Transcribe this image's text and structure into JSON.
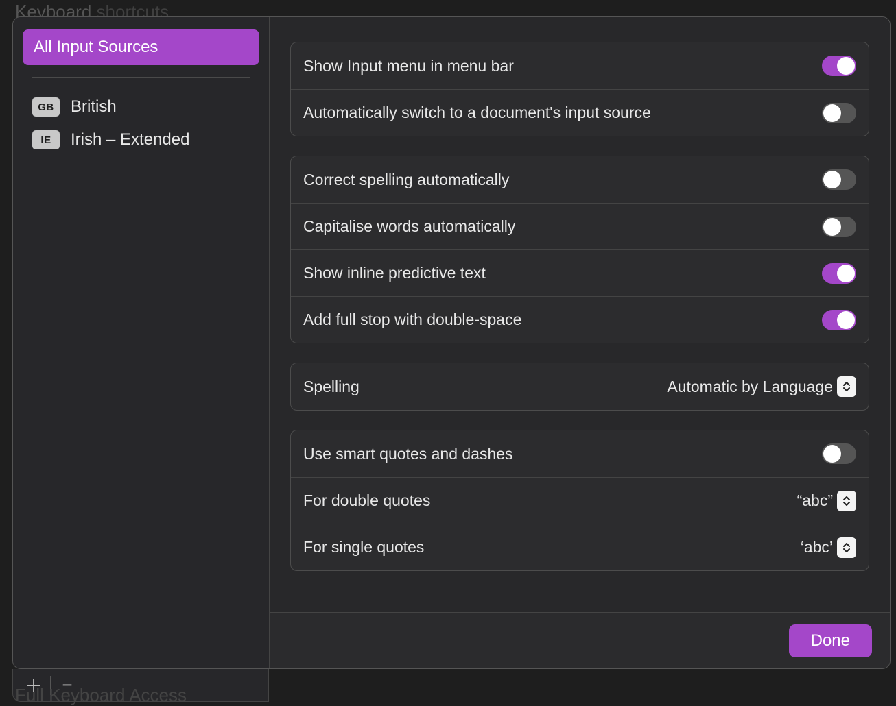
{
  "background": {
    "top_bold": "Keyboard",
    "top_light": "shortcuts",
    "bottom_text": "Full Keyboard Access"
  },
  "sidebar": {
    "header": "All Input Sources",
    "sources": [
      {
        "code": "GB",
        "name": "British"
      },
      {
        "code": "IE",
        "name": "Irish – Extended"
      }
    ]
  },
  "settings": {
    "group1": [
      {
        "label": "Show Input menu in menu bar",
        "on": true
      },
      {
        "label": "Automatically switch to a document's input source",
        "on": false
      }
    ],
    "group2": [
      {
        "label": "Correct spelling automatically",
        "on": false
      },
      {
        "label": "Capitalise words automatically",
        "on": false
      },
      {
        "label": "Show inline predictive text",
        "on": true
      },
      {
        "label": "Add full stop with double-space",
        "on": true
      }
    ],
    "spelling": {
      "label": "Spelling",
      "value": "Automatic by Language"
    },
    "quotes": {
      "smart": {
        "label": "Use smart quotes and dashes",
        "on": false
      },
      "double": {
        "label": "For double quotes",
        "value": "“abc”"
      },
      "single": {
        "label": "For single quotes",
        "value": "‘abc’"
      }
    }
  },
  "footer": {
    "done": "Done"
  }
}
